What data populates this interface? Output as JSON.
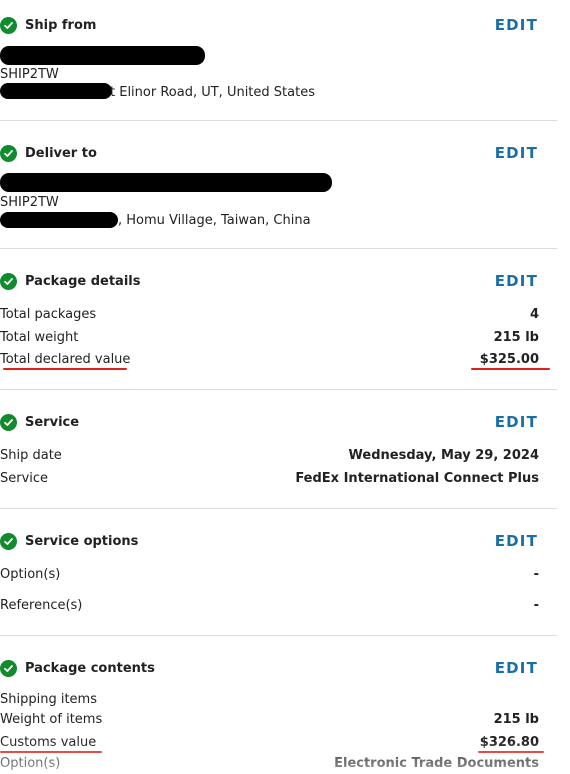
{
  "ship_from": {
    "title": "Ship from",
    "edit": "EDIT",
    "company": "SHIP2TW",
    "address_visible": "t Elinor Road, UT, United States"
  },
  "deliver_to": {
    "title": "Deliver to",
    "edit": "EDIT",
    "company": "SHIP2TW",
    "address_visible": ", Homu Village, Taiwan, China"
  },
  "package_details": {
    "title": "Package details",
    "edit": "EDIT",
    "rows": [
      {
        "label": "Total packages",
        "value": "4"
      },
      {
        "label": "Total weight",
        "value": "215 lb"
      },
      {
        "label": "Total declared value",
        "value": "$325.00"
      }
    ]
  },
  "service": {
    "title": "Service",
    "edit": "EDIT",
    "rows": [
      {
        "label": "Ship date",
        "value": "Wednesday, May 29, 2024"
      },
      {
        "label": "Service",
        "value": "FedEx International Connect Plus"
      }
    ]
  },
  "service_options": {
    "title": "Service options",
    "edit": "EDIT",
    "rows": [
      {
        "label": "Option(s)",
        "value": "-"
      },
      {
        "label": "Reference(s)",
        "value": "-"
      }
    ]
  },
  "package_contents": {
    "title": "Package contents",
    "edit": "EDIT",
    "rows": [
      {
        "label": "Shipping items",
        "value": ""
      },
      {
        "label": "Weight of items",
        "value": "215 lb"
      },
      {
        "label": "Customs value",
        "value": "$326.80"
      },
      {
        "label": "Option(s)",
        "value": "Electronic Trade Documents"
      }
    ]
  },
  "colors": {
    "check_green": "#128a2e",
    "edit_blue": "#1a6ea8",
    "annotation_red": "#e0201c"
  },
  "icons": [
    "check-circle-icon"
  ]
}
